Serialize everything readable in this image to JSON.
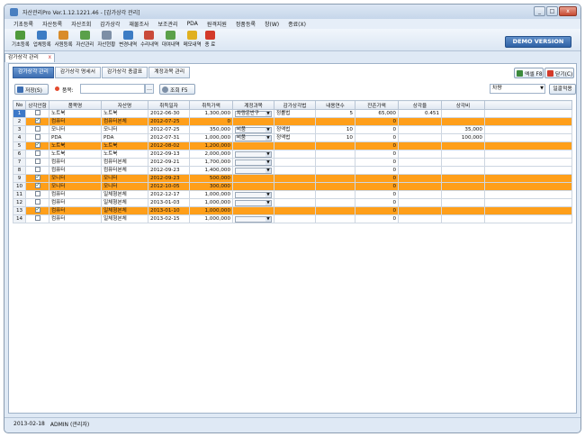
{
  "window": {
    "title": "자산관리Pro Ver.1.12.1221.46 - [감가상각 관리]",
    "min": "_",
    "max": "□",
    "close": "x"
  },
  "menu": [
    "기초등록",
    "자산등록",
    "자산조회",
    "감가상각",
    "재물조사",
    "보조관리",
    "PDA",
    "원격지원",
    "정품등록",
    "창(W)",
    "종료(X)"
  ],
  "toolbar": [
    {
      "label": "기초등록",
      "color": "#4f9a3c"
    },
    {
      "label": "업체등록",
      "color": "#3d7cc4"
    },
    {
      "label": "사원등록",
      "color": "#d98c2a"
    },
    {
      "label": "자산관리",
      "color": "#5aa04a"
    },
    {
      "label": "자산현황",
      "color": "#7d8fa6"
    },
    {
      "label": "변경내역",
      "color": "#3d7cc4"
    },
    {
      "label": "수리내역",
      "color": "#c94a3a"
    },
    {
      "label": "대여내역",
      "color": "#5aa04a"
    },
    {
      "label": "메모내역",
      "color": "#e0b020"
    },
    {
      "label": "종 료",
      "color": "#d33a2a"
    }
  ],
  "demo_label": "DEMO VERSION",
  "doc_tab": {
    "label": "감가상각 관리",
    "close": "x"
  },
  "subtabs": [
    "감가상각 관리",
    "감가상각 명세서",
    "감가상각 총괄표",
    "계정과목 관리"
  ],
  "excel_label": "엑셀 F8",
  "close_label": "닫기(C)",
  "search": {
    "save_label": "저장(S)",
    "item_label": "품목:",
    "item_value": "",
    "search_btn": "…",
    "query_label": "조회 F5",
    "select_value": "차량",
    "apply_label": "일괄적용"
  },
  "columns": [
    "No",
    "상각안함",
    "품목명",
    "자산명",
    "취득일자",
    "취득가액",
    "계정과목",
    "감가상각법",
    "내용연수",
    "잔존가액",
    "상각율",
    "상각비"
  ],
  "rows": [
    {
      "no": "1",
      "checked": false,
      "hl": false,
      "sel": true,
      "item": "노트북",
      "asset": "노트북",
      "date": "2012-06-30",
      "price": "1,300,000",
      "account": "차량운반구",
      "method": "정률법",
      "life": "5",
      "residual": "65,000",
      "rate": "0.451",
      "dep": ""
    },
    {
      "no": "2",
      "checked": true,
      "hl": true,
      "sel": false,
      "item": "컴퓨터",
      "asset": "컴퓨터본체",
      "date": "2012-07-25",
      "price": "0",
      "account": "",
      "method": "",
      "life": "",
      "residual": "0",
      "rate": "",
      "dep": ""
    },
    {
      "no": "3",
      "checked": false,
      "hl": false,
      "sel": false,
      "item": "모니터",
      "asset": "모니터",
      "date": "2012-07-25",
      "price": "350,000",
      "account": "비품",
      "method": "정액법",
      "life": "10",
      "residual": "0",
      "rate": "",
      "dep": "35,000"
    },
    {
      "no": "4",
      "checked": false,
      "hl": false,
      "sel": false,
      "item": "PDA",
      "asset": "PDA",
      "date": "2012-07-31",
      "price": "1,000,000",
      "account": "비품",
      "method": "정액법",
      "life": "10",
      "residual": "0",
      "rate": "",
      "dep": "100,000"
    },
    {
      "no": "5",
      "checked": true,
      "hl": true,
      "sel": false,
      "item": "노트북",
      "asset": "노트북",
      "date": "2012-08-02",
      "price": "1,200,000",
      "account": "",
      "method": "",
      "life": "",
      "residual": "0",
      "rate": "",
      "dep": ""
    },
    {
      "no": "6",
      "checked": false,
      "hl": false,
      "sel": false,
      "item": "노트북",
      "asset": "노트북",
      "date": "2012-09-13",
      "price": "2,000,000",
      "account": "",
      "method": "",
      "life": "",
      "residual": "0",
      "rate": "",
      "dep": ""
    },
    {
      "no": "7",
      "checked": false,
      "hl": false,
      "sel": false,
      "item": "컴퓨터",
      "asset": "컴퓨터본체",
      "date": "2012-09-21",
      "price": "1,700,000",
      "account": "",
      "method": "",
      "life": "",
      "residual": "0",
      "rate": "",
      "dep": ""
    },
    {
      "no": "8",
      "checked": false,
      "hl": false,
      "sel": false,
      "item": "컴퓨터",
      "asset": "컴퓨터본체",
      "date": "2012-09-23",
      "price": "1,400,000",
      "account": "",
      "method": "",
      "life": "",
      "residual": "0",
      "rate": "",
      "dep": ""
    },
    {
      "no": "9",
      "checked": true,
      "hl": true,
      "sel": false,
      "item": "모니터",
      "asset": "모니터",
      "date": "2012-09-23",
      "price": "500,000",
      "account": "",
      "method": "",
      "life": "",
      "residual": "0",
      "rate": "",
      "dep": ""
    },
    {
      "no": "10",
      "checked": true,
      "hl": true,
      "sel": false,
      "item": "모니터",
      "asset": "모니터",
      "date": "2012-10-05",
      "price": "300,000",
      "account": "",
      "method": "",
      "life": "",
      "residual": "0",
      "rate": "",
      "dep": ""
    },
    {
      "no": "11",
      "checked": false,
      "hl": false,
      "sel": false,
      "item": "컴퓨터",
      "asset": "일체형본체",
      "date": "2012-12-17",
      "price": "1,000,000",
      "account": "",
      "method": "",
      "life": "",
      "residual": "0",
      "rate": "",
      "dep": ""
    },
    {
      "no": "12",
      "checked": false,
      "hl": false,
      "sel": false,
      "item": "컴퓨터",
      "asset": "일체형본체",
      "date": "2013-01-03",
      "price": "1,000,000",
      "account": "",
      "method": "",
      "life": "",
      "residual": "0",
      "rate": "",
      "dep": ""
    },
    {
      "no": "13",
      "checked": true,
      "hl": true,
      "sel": false,
      "item": "컴퓨터",
      "asset": "일체형본체",
      "date": "2013-01-10",
      "price": "1,000,000",
      "account": "",
      "method": "",
      "life": "",
      "residual": "0",
      "rate": "",
      "dep": ""
    },
    {
      "no": "14",
      "checked": false,
      "hl": false,
      "sel": false,
      "item": "컴퓨터",
      "asset": "일체형본체",
      "date": "2013-02-15",
      "price": "1,000,000",
      "account": "",
      "method": "",
      "life": "",
      "residual": "0",
      "rate": "",
      "dep": ""
    }
  ],
  "status": {
    "date": "2013-02-18",
    "user": "ADMIN (관리자)"
  }
}
